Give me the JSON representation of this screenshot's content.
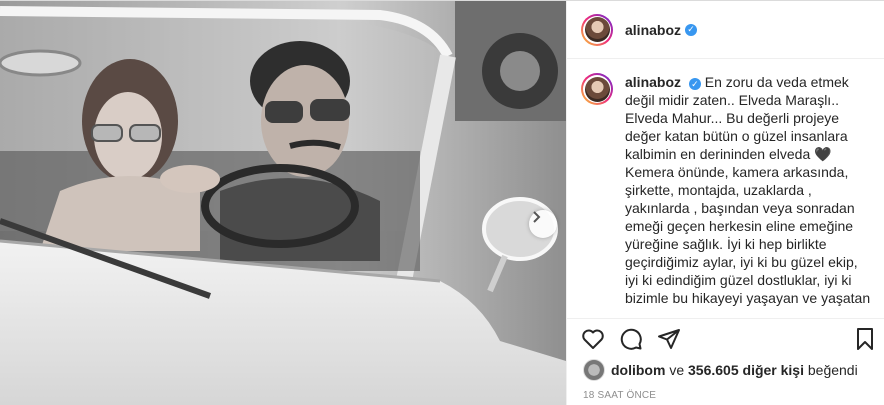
{
  "post": {
    "username": "alinaboz",
    "verified_icon": "verified-badge-icon",
    "caption_lines": [
      "En zoru da veda etmek",
      "değil midir zaten.. Elveda Maraşlı..",
      "Elveda Mahur... Bu değerli projeye",
      "değer katan bütün o güzel insanlara",
      "kalbimin en derininden elveda 🖤",
      "Kemera önünde, kamera arkasında,",
      "şirkette, montajda, uzaklarda ,",
      "yakınlarda , başından veya sonradan",
      "emeği geçen herkesin eline emeğine",
      "yüreğine sağlık. İyi ki hep birlikte",
      "geçirdiğimiz aylar, iyi ki bu güzel ekip,",
      "iyi ki edindiğim güzel dostluklar, iyi ki",
      "bizimle bu hikayeyi yaşayan ve yaşatan"
    ],
    "likes_user": "dolibom",
    "likes_text_mid": " ve ",
    "likes_others": "356.605 diğer kişi",
    "likes_text_end": " beğendi",
    "time": "18 SAAT ÖNCE"
  },
  "icons": {
    "like": "heart-icon",
    "comment": "comment-icon",
    "share": "share-icon",
    "save": "bookmark-icon",
    "next": "chevron-right-icon"
  }
}
